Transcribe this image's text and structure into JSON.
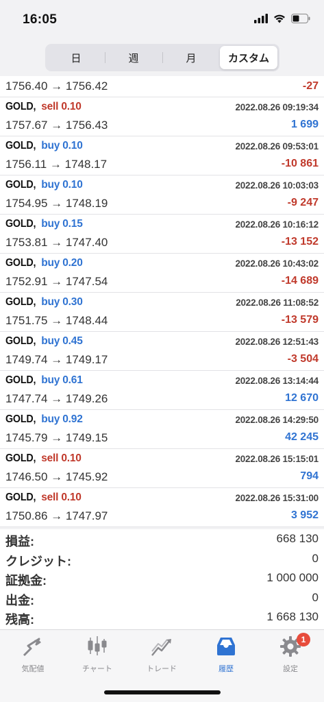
{
  "status": {
    "time": "16:05"
  },
  "tabs_period": [
    {
      "label": "日",
      "active": false
    },
    {
      "label": "週",
      "active": false
    },
    {
      "label": "月",
      "active": false
    },
    {
      "label": "カスタム",
      "active": true
    }
  ],
  "first_row": {
    "prices": "1756.40 → 1756.42",
    "profit": "-27",
    "profit_sign": "neg"
  },
  "deals": [
    {
      "symbol": "GOLD,",
      "side": "sell",
      "volume": "sell 0.10",
      "time": "2022.08.26 09:19:34",
      "prices": "1757.67 → 1756.43",
      "profit": "1 699",
      "profit_sign": "pos"
    },
    {
      "symbol": "GOLD,",
      "side": "buy",
      "volume": "buy 0.10",
      "time": "2022.08.26 09:53:01",
      "prices": "1756.11 → 1748.17",
      "profit": "-10 861",
      "profit_sign": "neg"
    },
    {
      "symbol": "GOLD,",
      "side": "buy",
      "volume": "buy 0.10",
      "time": "2022.08.26 10:03:03",
      "prices": "1754.95 → 1748.19",
      "profit": "-9 247",
      "profit_sign": "neg"
    },
    {
      "symbol": "GOLD,",
      "side": "buy",
      "volume": "buy 0.15",
      "time": "2022.08.26 10:16:12",
      "prices": "1753.81 → 1747.40",
      "profit": "-13 152",
      "profit_sign": "neg"
    },
    {
      "symbol": "GOLD,",
      "side": "buy",
      "volume": "buy 0.20",
      "time": "2022.08.26 10:43:02",
      "prices": "1752.91 → 1747.54",
      "profit": "-14 689",
      "profit_sign": "neg"
    },
    {
      "symbol": "GOLD,",
      "side": "buy",
      "volume": "buy 0.30",
      "time": "2022.08.26 11:08:52",
      "prices": "1751.75 → 1748.44",
      "profit": "-13 579",
      "profit_sign": "neg"
    },
    {
      "symbol": "GOLD,",
      "side": "buy",
      "volume": "buy 0.45",
      "time": "2022.08.26 12:51:43",
      "prices": "1749.74 → 1749.17",
      "profit": "-3 504",
      "profit_sign": "neg"
    },
    {
      "symbol": "GOLD,",
      "side": "buy",
      "volume": "buy 0.61",
      "time": "2022.08.26 13:14:44",
      "prices": "1747.74 → 1749.26",
      "profit": "12 670",
      "profit_sign": "pos"
    },
    {
      "symbol": "GOLD,",
      "side": "buy",
      "volume": "buy 0.92",
      "time": "2022.08.26 14:29:50",
      "prices": "1745.79 → 1749.15",
      "profit": "42 245",
      "profit_sign": "pos"
    },
    {
      "symbol": "GOLD,",
      "side": "sell",
      "volume": "sell 0.10",
      "time": "2022.08.26 15:15:01",
      "prices": "1746.50 → 1745.92",
      "profit": "794",
      "profit_sign": "pos"
    },
    {
      "symbol": "GOLD,",
      "side": "sell",
      "volume": "sell 0.10",
      "time": "2022.08.26 15:31:00",
      "prices": "1750.86 → 1747.97",
      "profit": "3 952",
      "profit_sign": "pos"
    }
  ],
  "summary": [
    {
      "label": "損益:",
      "value": "668 130"
    },
    {
      "label": "クレジット:",
      "value": "0"
    },
    {
      "label": "証拠金:",
      "value": "1 000 000"
    },
    {
      "label": "出金:",
      "value": "0"
    },
    {
      "label": "残高:",
      "value": "1 668 130"
    }
  ],
  "tabbar": [
    {
      "label": "気配値",
      "icon": "quotes-icon",
      "active": false
    },
    {
      "label": "チャート",
      "icon": "chart-icon",
      "active": false
    },
    {
      "label": "トレード",
      "icon": "trade-icon",
      "active": false
    },
    {
      "label": "履歴",
      "icon": "history-icon",
      "active": true
    },
    {
      "label": "設定",
      "icon": "settings-icon",
      "active": false,
      "badge": "1"
    }
  ],
  "colors": {
    "negative": "#c0392b",
    "positive": "#2f73d2",
    "accent": "#2f73d2",
    "badge": "#e74c3c"
  }
}
